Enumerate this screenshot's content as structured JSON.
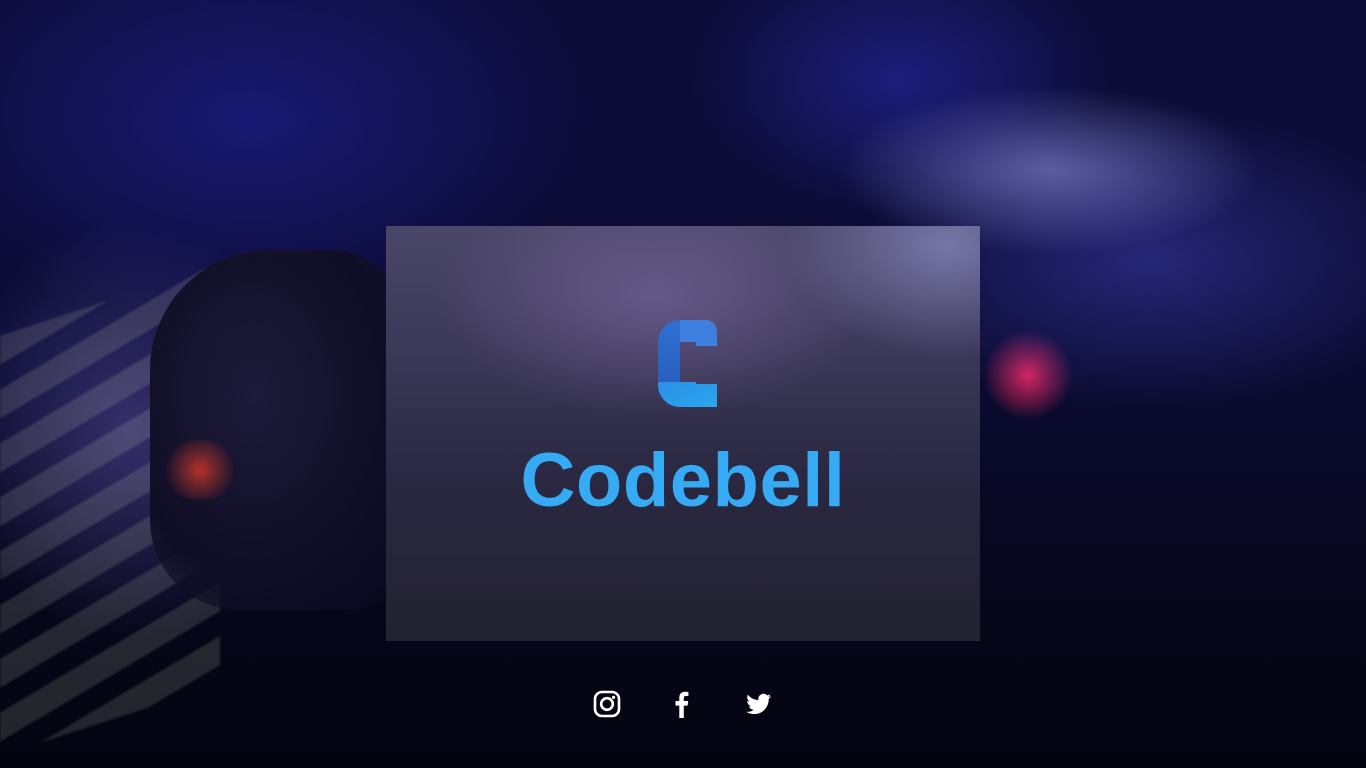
{
  "brand": {
    "name": "Codebell",
    "logo_icon": "codebell-c-logo-icon",
    "accent_color": "#36aaf2"
  },
  "social_links": [
    {
      "network": "instagram",
      "icon": "instagram-icon"
    },
    {
      "network": "facebook",
      "icon": "facebook-icon"
    },
    {
      "network": "twitter",
      "icon": "twitter-icon"
    }
  ],
  "colors": {
    "icon": "#ffffff",
    "card": "#2f2c45",
    "background": "#0b0b33"
  }
}
